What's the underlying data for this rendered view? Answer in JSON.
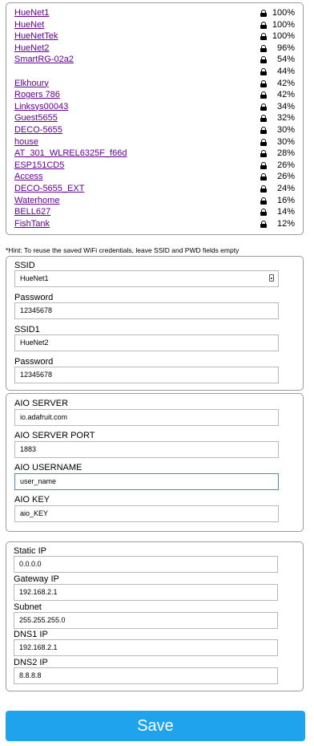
{
  "networks": [
    {
      "name": "HueNet1",
      "signal": "100%"
    },
    {
      "name": "HueNet",
      "signal": "100%"
    },
    {
      "name": "HueNetTek",
      "signal": "100%"
    },
    {
      "name": "HueNet2",
      "signal": "96%"
    },
    {
      "name": "SmartRG-02a2",
      "signal": "54%"
    },
    {
      "name": "",
      "signal": "44%"
    },
    {
      "name": "Elkhoury",
      "signal": "42%"
    },
    {
      "name": "Rogers 786",
      "signal": "42%"
    },
    {
      "name": "Linksys00043",
      "signal": "34%"
    },
    {
      "name": "Guest5655",
      "signal": "32%"
    },
    {
      "name": "DECO-5655",
      "signal": "30%"
    },
    {
      "name": "house",
      "signal": "30%"
    },
    {
      "name": "AT_301_WLREL6325F_f66d",
      "signal": "28%"
    },
    {
      "name": "ESP151CD5",
      "signal": "26%"
    },
    {
      "name": "Access",
      "signal": "26%"
    },
    {
      "name": "DECO-5655_EXT",
      "signal": "24%"
    },
    {
      "name": "Waterhome",
      "signal": "16%"
    },
    {
      "name": "BELL627",
      "signal": "14%"
    },
    {
      "name": "FishTank",
      "signal": "12%"
    }
  ],
  "hint": "*Hint: To reuse the saved WiFi credentials, leave SSID and PWD fields empty",
  "credentials": {
    "ssid_label": "SSID",
    "ssid_value": "HueNet1",
    "password_label": "Password",
    "password_value": "12345678",
    "ssid1_label": "SSID1",
    "ssid1_value": "HueNet2",
    "password1_label": "Password",
    "password1_value": "12345678"
  },
  "aio": {
    "server_label": "AIO SERVER",
    "server_value": "io.adafruit.com",
    "port_label": "AIO SERVER PORT",
    "port_value": "1883",
    "username_label": "AIO USERNAME",
    "username_value": "user_name",
    "key_label": "AIO KEY",
    "key_value": "aio_KEY"
  },
  "network": {
    "static_ip_label": "Static IP",
    "static_ip_value": "0.0.0.0",
    "gateway_label": "Gateway IP",
    "gateway_value": "192.168.2.1",
    "subnet_label": "Subnet",
    "subnet_value": "255.255.255.0",
    "dns1_label": "DNS1 IP",
    "dns1_value": "192.168.2.1",
    "dns2_label": "DNS2 IP",
    "dns2_value": "8.8.8.8"
  },
  "save_label": "Save",
  "colors": {
    "link": "#660099",
    "save_button": "#1fa3ec",
    "border": "#9a9a9a"
  }
}
